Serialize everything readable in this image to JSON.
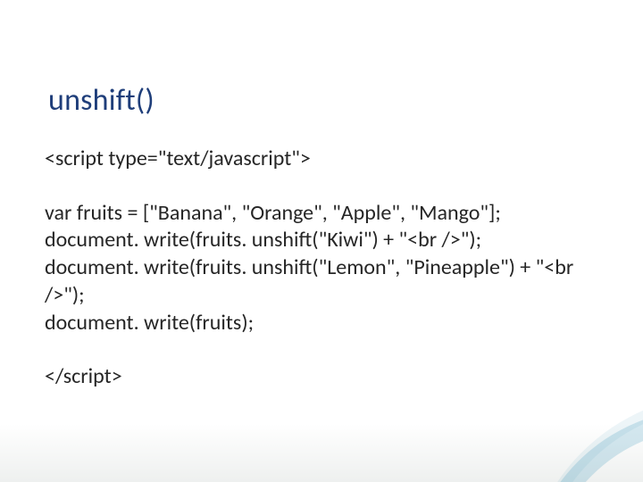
{
  "slide": {
    "title": "unshift()",
    "code": {
      "open_tag": "<script type=\"text/javascript\">",
      "line1": "var fruits = [\"Banana\", \"Orange\", \"Apple\", \"Mango\"];",
      "line2": "document. write(fruits. unshift(\"Kiwi\") + \"<br />\");",
      "line3": "document. write(fruits. unshift(\"Lemon\", \"Pineapple\") + \"<br />\");",
      "line4": "document. write(fruits);",
      "close_tag": "</script>"
    }
  }
}
